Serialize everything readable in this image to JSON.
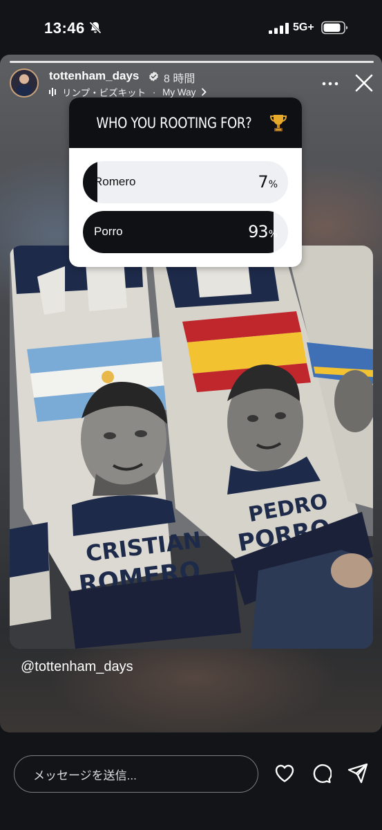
{
  "status_bar": {
    "time": "13:46",
    "network": "5G+",
    "icons": [
      "bell-off-icon",
      "signal-icon",
      "battery-icon"
    ]
  },
  "story": {
    "username": "tottenham_days",
    "post_time": "8 時間",
    "music": {
      "artist": "リンプ・ビズキット",
      "separator": " · ",
      "song": "My Way"
    },
    "poll": {
      "question": "WHO YOU ROOTING FOR?",
      "question_icon": "trophy-icon",
      "options": [
        {
          "label": "Romero",
          "percent": 7,
          "sign": "%"
        },
        {
          "label": "Porro",
          "percent": 93,
          "sign": "%"
        }
      ]
    },
    "photo": {
      "scarves": [
        {
          "line1": "CRISTIAN",
          "line2": "ROMERO"
        },
        {
          "line1": "PEDRO",
          "line2": "PORRO"
        }
      ]
    },
    "mention": "@tottenham_days"
  },
  "bottom_bar": {
    "message_placeholder": "メッセージを送信...",
    "icons": [
      "heart-icon",
      "comment-icon",
      "send-icon"
    ]
  },
  "colors": {
    "background": "#121417",
    "poll_header": "#0e1013",
    "poll_fill": "#0f1114",
    "poll_track": "#eef0f3"
  }
}
